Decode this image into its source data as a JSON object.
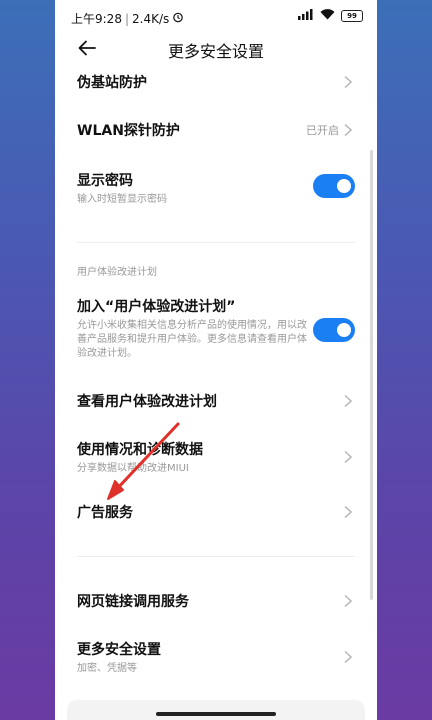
{
  "status_bar": {
    "time": "上午9:28",
    "speed": "2.4K/s",
    "battery": "99"
  },
  "header": {
    "title": "更多安全设置"
  },
  "items": {
    "fake_base_station": {
      "title": "伪基站防护"
    },
    "wlan_probe": {
      "title": "WLAN探针防护",
      "value": "已开启"
    },
    "show_password": {
      "title": "显示密码",
      "subtitle": "输入时短暂显示密码",
      "enabled": true
    },
    "join_program": {
      "title": "加入“用户体验改进计划”",
      "subtitle": "允许小米收集相关信息分析产品的使用情况，用以改善产品服务和提升用户体验。更多信息请查看用户体验改进计划。",
      "enabled": true
    },
    "view_program": {
      "title": "查看用户体验改进计划"
    },
    "usage_diagnostics": {
      "title": "使用情况和诊断数据",
      "subtitle": "分享数据以帮助改进MIUI"
    },
    "ad_service": {
      "title": "广告服务"
    },
    "web_link": {
      "title": "网页链接调用服务"
    },
    "more_security": {
      "title": "更多安全设置",
      "subtitle": "加密、凭据等"
    }
  },
  "sections": {
    "ux_program": "用户体验改进计划"
  },
  "colors": {
    "accent": "#1a7ff2",
    "arrow": "#e0302a"
  }
}
